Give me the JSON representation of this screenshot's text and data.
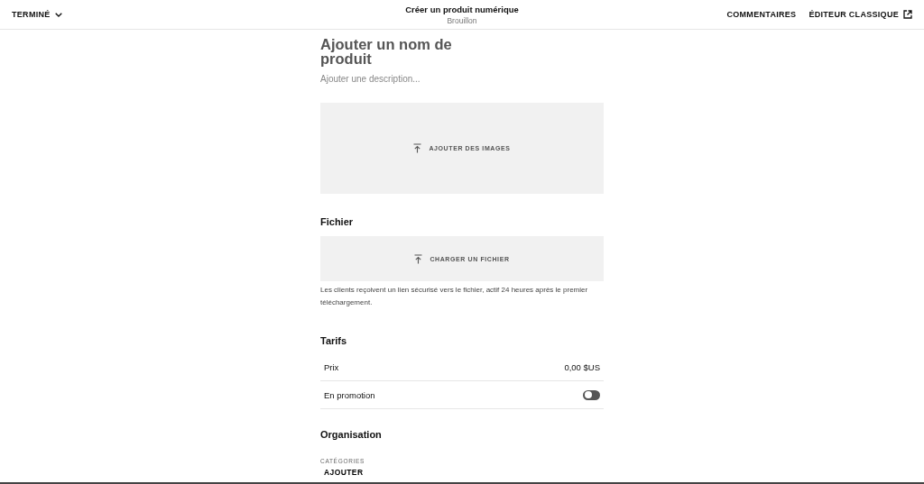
{
  "top_bar": {
    "done_menu": "TERMINÉ",
    "title": "Créer un produit numérique",
    "status": "Brouillon",
    "comments": "COMMENTAIRES",
    "classic_editor": "ÉDITEUR CLASSIQUE"
  },
  "product": {
    "name_placeholder": "Ajouter un nom de produit",
    "description_placeholder": "Ajouter une description...",
    "images_button": "AJOUTER DES IMAGES"
  },
  "file_section": {
    "heading": "Fichier",
    "upload_button": "CHARGER UN FICHIER",
    "help": "Les clients reçoivent un lien sécurisé vers le fichier, actif 24 heures après le premier téléchargement."
  },
  "pricing": {
    "heading": "Tarifs",
    "rows": [
      {
        "kind": "value",
        "label": "Prix",
        "value": "0,00 $US"
      },
      {
        "kind": "toggle",
        "label": "En promotion",
        "on": false
      }
    ]
  },
  "organisation": {
    "heading": "Organisation",
    "categories_label": "CATÉGORIES",
    "add_button": "AJOUTER"
  }
}
